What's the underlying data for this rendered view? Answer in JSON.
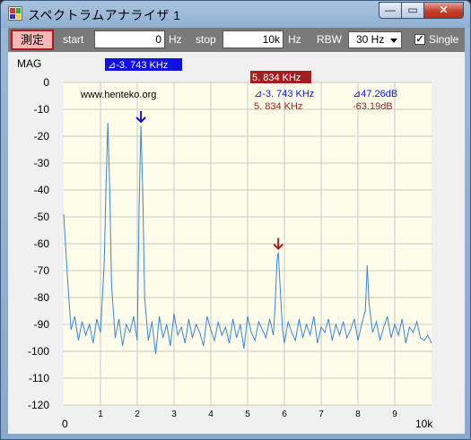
{
  "window": {
    "title": "スペクトラムアナライザ 1",
    "close_glyph": "✕",
    "min_glyph": "—",
    "max_glyph": "▭"
  },
  "toolbar": {
    "measure_label": "測定",
    "start_label": "start",
    "start_value": "0",
    "start_unit": "Hz",
    "stop_label": "stop",
    "stop_value": "10k",
    "stop_unit": "Hz",
    "rbw_label": "RBW",
    "rbw_value": "30 Hz",
    "single_label": "Single",
    "single_checked": "✓"
  },
  "plot": {
    "y_axis_title": "MAG",
    "watermark": "www.henteko.org",
    "delta_marker_box": "⊿-3. 743 KHz",
    "marker_box": "5. 834 KHz",
    "readout_delta_freq": "⊿-3. 743 KHz",
    "readout_delta_db": "⊿47.26dB",
    "readout_marker_freq": "5. 834 KHz",
    "readout_marker_db": "-63.19dB",
    "x_start_label": "0",
    "x_end_label": "10k"
  },
  "chart_data": {
    "type": "line",
    "ylabel": "MAG",
    "ylim": [
      -120,
      0
    ],
    "xlim": [
      0,
      10
    ],
    "y_ticks": [
      "0",
      "-10",
      "-20",
      "-30",
      "-40",
      "-50",
      "-60",
      "-70",
      "-80",
      "-90",
      "-100",
      "-110",
      "-120"
    ],
    "x_ticks": [
      "1",
      "2",
      "3",
      "4",
      "5",
      "6",
      "7",
      "8",
      "9"
    ],
    "grid": true,
    "colors": {
      "trace": "#3a86d6",
      "delta_marker": "#1010e0",
      "marker": "#a31f1f",
      "plot_bg": "#fdfde9"
    },
    "markers": [
      {
        "name": "delta",
        "x": 2.1,
        "y": -16
      },
      {
        "name": "main",
        "x": 5.834,
        "y": -63.19
      }
    ],
    "series": [
      {
        "x": [
          0.0,
          0.1,
          0.2,
          0.3,
          0.4,
          0.5,
          0.6,
          0.7,
          0.8,
          0.9,
          1.0,
          1.1,
          1.15,
          1.2,
          1.25,
          1.3,
          1.4,
          1.5,
          1.6,
          1.7,
          1.8,
          1.9,
          2.0,
          2.05,
          2.1,
          2.15,
          2.2,
          2.3,
          2.4,
          2.5,
          2.6,
          2.7,
          2.8,
          2.9,
          3.0,
          3.1,
          3.2,
          3.3,
          3.4,
          3.5,
          3.6,
          3.7,
          3.8,
          3.9,
          4.0,
          4.1,
          4.2,
          4.3,
          4.4,
          4.5,
          4.6,
          4.7,
          4.8,
          4.9,
          5.0,
          5.1,
          5.2,
          5.3,
          5.4,
          5.5,
          5.6,
          5.7,
          5.75,
          5.8,
          5.834,
          5.9,
          5.95,
          6.0,
          6.1,
          6.2,
          6.3,
          6.4,
          6.5,
          6.6,
          6.7,
          6.8,
          6.9,
          7.0,
          7.1,
          7.2,
          7.3,
          7.4,
          7.5,
          7.6,
          7.7,
          7.8,
          7.9,
          8.0,
          8.1,
          8.2,
          8.25,
          8.3,
          8.4,
          8.5,
          8.6,
          8.7,
          8.8,
          8.9,
          9.0,
          9.1,
          9.2,
          9.3,
          9.4,
          9.5,
          9.6,
          9.7,
          9.8,
          9.9,
          10.0
        ],
        "y": [
          -49,
          -72,
          -92,
          -87,
          -96,
          -89,
          -94,
          -90,
          -97,
          -88,
          -93,
          -68,
          -38,
          -15,
          -40,
          -75,
          -95,
          -88,
          -98,
          -90,
          -93,
          -87,
          -96,
          -45,
          -16,
          -42,
          -80,
          -96,
          -89,
          -101,
          -87,
          -95,
          -90,
          -98,
          -86,
          -94,
          -91,
          -97,
          -88,
          -95,
          -90,
          -93,
          -98,
          -87,
          -92,
          -96,
          -89,
          -94,
          -91,
          -97,
          -88,
          -95,
          -90,
          -99,
          -87,
          -93,
          -96,
          -89,
          -92,
          -95,
          -88,
          -94,
          -82,
          -66,
          -63.19,
          -80,
          -92,
          -97,
          -89,
          -93,
          -96,
          -88,
          -95,
          -90,
          -94,
          -87,
          -97,
          -91,
          -93,
          -88,
          -96,
          -90,
          -94,
          -89,
          -95,
          -92,
          -88,
          -96,
          -90,
          -85,
          -68,
          -82,
          -93,
          -89,
          -96,
          -91,
          -87,
          -95,
          -90,
          -94,
          -88,
          -97,
          -91,
          -93,
          -89,
          -95,
          -96,
          -94,
          -97
        ]
      }
    ]
  }
}
